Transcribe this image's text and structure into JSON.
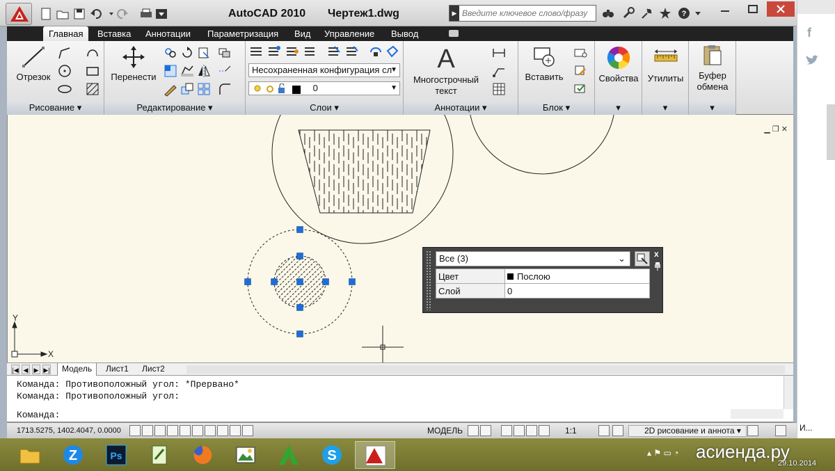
{
  "window": {
    "app_title": "AutoCAD 2010",
    "file_title": "Чертеж1.dwg",
    "search_placeholder": "Введите ключевое слово/фразу"
  },
  "ribbon": {
    "tabs": [
      "Главная",
      "Вставка",
      "Аннотации",
      "Параметризация",
      "Вид",
      "Управление",
      "Вывод"
    ],
    "active_tab": "Главная",
    "panels": {
      "draw": {
        "title": "Рисование",
        "big_button": "Отрезок"
      },
      "modify": {
        "title": "Редактирование",
        "big_button": "Перенести"
      },
      "layers": {
        "title": "Слои",
        "layer_state": "Несохраненная конфигурация сл",
        "current_layer": "0"
      },
      "annotation": {
        "title": "Аннотации",
        "big_button_line1": "Многострочный",
        "big_button_line2": "текст"
      },
      "block": {
        "title": "Блок",
        "big_button": "Вставить"
      },
      "properties": {
        "label": "Свойства"
      },
      "utilities": {
        "label": "Утилиты"
      },
      "clipboard": {
        "label_line1": "Буфер",
        "label_line2": "обмена"
      }
    }
  },
  "ucs": {
    "y_label": "Y",
    "x_label": "X"
  },
  "quick_properties": {
    "selection": "Все (3)",
    "rows": [
      {
        "key": "Цвет",
        "value": "Послою"
      },
      {
        "key": "Слой",
        "value": "0"
      }
    ],
    "close_label": "x"
  },
  "layout_tabs": [
    "Модель",
    "Лист1",
    "Лист2"
  ],
  "command_line": {
    "history": [
      "Команда: Противоположный угол: *Прервано*",
      "Команда: Противоположный угол:"
    ],
    "prompt": "Команда:"
  },
  "statusbar": {
    "coords": "1713.5275, 1402.4047, 0.0000",
    "space": "МОДЕЛЬ",
    "scale": "1:1",
    "workspace": "2D рисование и аннота"
  },
  "taskbar": {
    "watermark": "асиенда.ру",
    "date": "29.10.2014",
    "right_strip_label": "И..."
  },
  "colors": {
    "canvas_bg": "#fbf8e9",
    "grip": "#1e6ed8",
    "taskbar": "#7f7f36",
    "ribbon_tabs_bg": "#222222"
  }
}
